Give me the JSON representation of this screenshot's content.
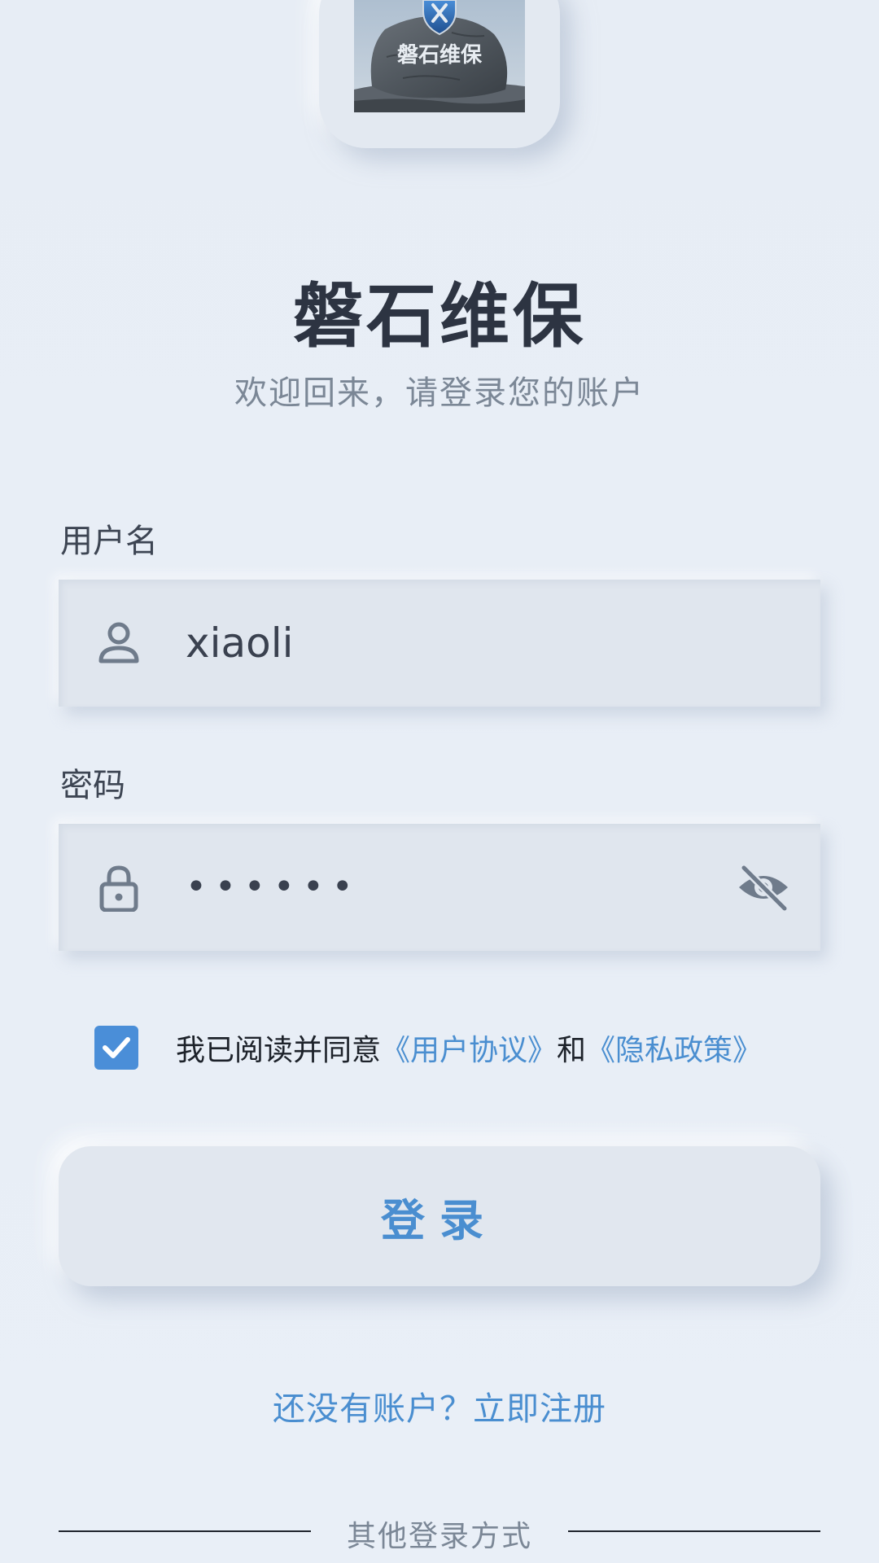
{
  "app": {
    "logo_text": "磐石维保",
    "title": "磐石维保",
    "subtitle": "欢迎回来，请登录您的账户"
  },
  "form": {
    "username_label": "用户名",
    "username_value": "xiaoli",
    "username_icon": "user-icon",
    "password_label": "密码",
    "password_value": "••••••",
    "password_icon": "lock-icon",
    "toggle_icon": "eye-off-icon"
  },
  "agreement": {
    "checked": true,
    "prefix": "我已阅读并同意",
    "user_agreement": "《用户协议》",
    "conjunction": "和",
    "privacy_policy": "《隐私政策》"
  },
  "actions": {
    "login_label": "登录",
    "register_prompt": "还没有账户？立即注册"
  },
  "other_login": {
    "label": "其他登录方式"
  },
  "colors": {
    "accent": "#4a8ed0",
    "background": "#e8eef6",
    "title": "#2d3442"
  }
}
